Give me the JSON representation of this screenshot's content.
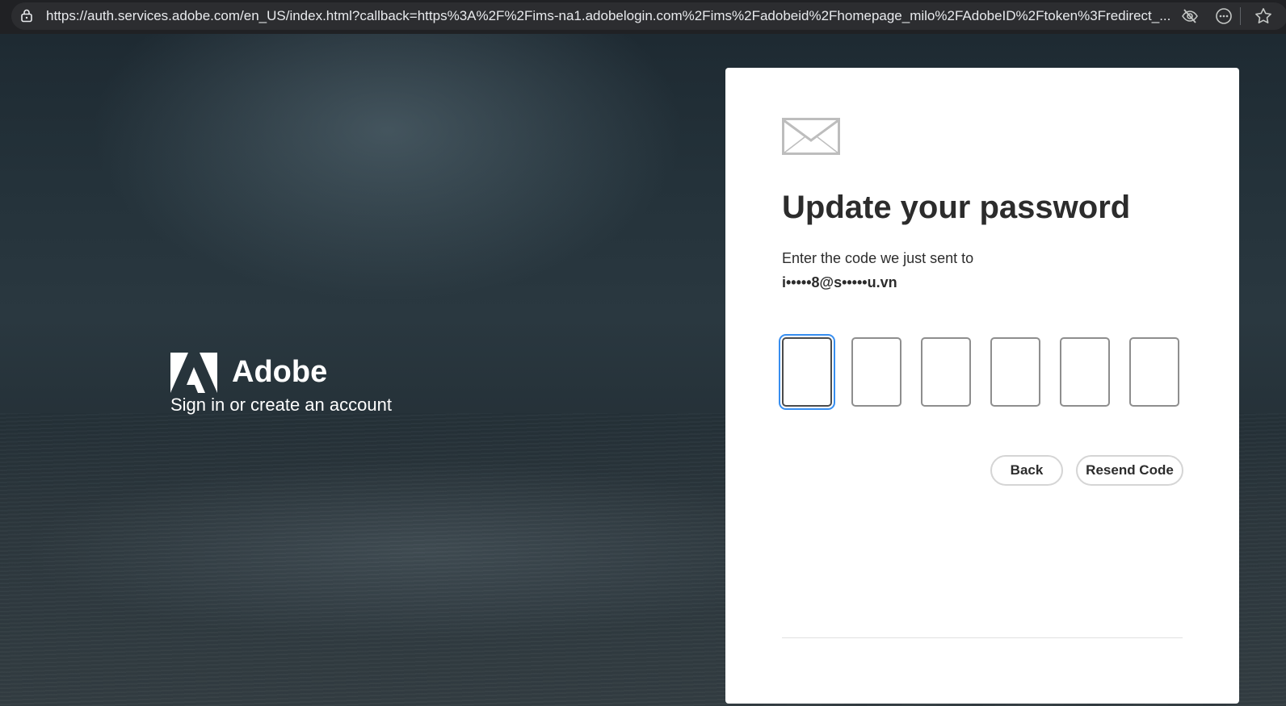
{
  "browser": {
    "url": "https://auth.services.adobe.com/en_US/index.html?callback=https%3A%2F%2Fims-na1.adobelogin.com%2Fims%2Fadobeid%2Fhomepage_milo%2FAdobeID%2Ftoken%3Fredirect_..."
  },
  "brand": {
    "name": "Adobe",
    "tagline": "Sign in or create an account"
  },
  "card": {
    "icon": "mail-icon",
    "title": "Update your password",
    "instruction": "Enter the code we just sent to",
    "masked_email": "i•••••8@s•••••u.vn",
    "code_digits": [
      "",
      "",
      "",
      "",
      "",
      ""
    ],
    "focused_digit": 1,
    "back_label": "Back",
    "resend_label": "Resend Code"
  },
  "colors": {
    "focus_ring": "#378ef0",
    "title_text": "#2c2c2c",
    "card_bg": "#ffffff"
  }
}
